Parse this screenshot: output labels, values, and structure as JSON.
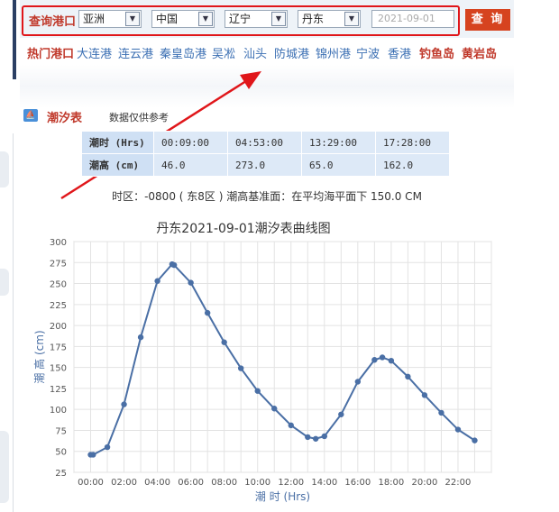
{
  "query": {
    "label": "查询港口",
    "region": "亚洲",
    "country": "中国",
    "province": "辽宁",
    "port": "丹东",
    "date_placeholder": "2021-09-01",
    "button_label": "查 询"
  },
  "hot_ports": {
    "label": "热门港口",
    "items": [
      "大连港",
      "连云港",
      "秦皇岛港",
      "吴凇",
      "汕头",
      "防城港",
      "锦州港",
      "宁波",
      "香港",
      "钓鱼岛",
      "黄岩岛"
    ],
    "highlighted": [
      "钓鱼岛",
      "黄岩岛"
    ]
  },
  "tide_section": {
    "title": "潮汐表",
    "note": "数据仅供参考",
    "row_time_label": "潮时 (Hrs)",
    "row_height_label": "潮高 (cm)",
    "times": [
      "00:09:00",
      "04:53:00",
      "13:29:00",
      "17:28:00"
    ],
    "heights": [
      "46.0",
      "273.0",
      "65.0",
      "162.0"
    ],
    "zone_text": "时区：-0800 ( 东8区 ) 潮高基准面：在平均海平面下 150.0 CM"
  },
  "chart_data": {
    "type": "line",
    "title": "丹东2021-09-01潮汐表曲线图",
    "xlabel": "潮 时 (Hrs)",
    "ylabel": "潮 高 (cm)",
    "ylim": [
      25,
      300
    ],
    "yticks": [
      25,
      50,
      75,
      100,
      125,
      150,
      175,
      200,
      225,
      250,
      275,
      300
    ],
    "xlim": [
      -1,
      24
    ],
    "xticks": [
      "00:00",
      "02:00",
      "04:00",
      "06:00",
      "08:00",
      "10:00",
      "12:00",
      "14:00",
      "16:00",
      "18:00",
      "20:00",
      "22:00"
    ],
    "grid": true,
    "color": "#4a6fa5",
    "x": [
      0,
      0.15,
      1,
      2,
      3,
      4,
      4.88,
      5,
      6,
      7,
      8,
      9,
      10,
      11,
      12,
      13,
      13.48,
      14,
      15,
      16,
      17,
      17.47,
      18,
      19,
      20,
      21,
      22,
      23
    ],
    "y": [
      46,
      46,
      55,
      106,
      186,
      253,
      273,
      272,
      251,
      215,
      180,
      149,
      122,
      101,
      81,
      67,
      65,
      68,
      94,
      133,
      159,
      162,
      158,
      139,
      117,
      96,
      76,
      63
    ]
  },
  "colors": {
    "accent_red": "#c0392b",
    "link_blue": "#3b6fb3",
    "button_bg": "#d6431f",
    "annotation_red": "#e0161a",
    "table_header": "#cfe0f4"
  }
}
